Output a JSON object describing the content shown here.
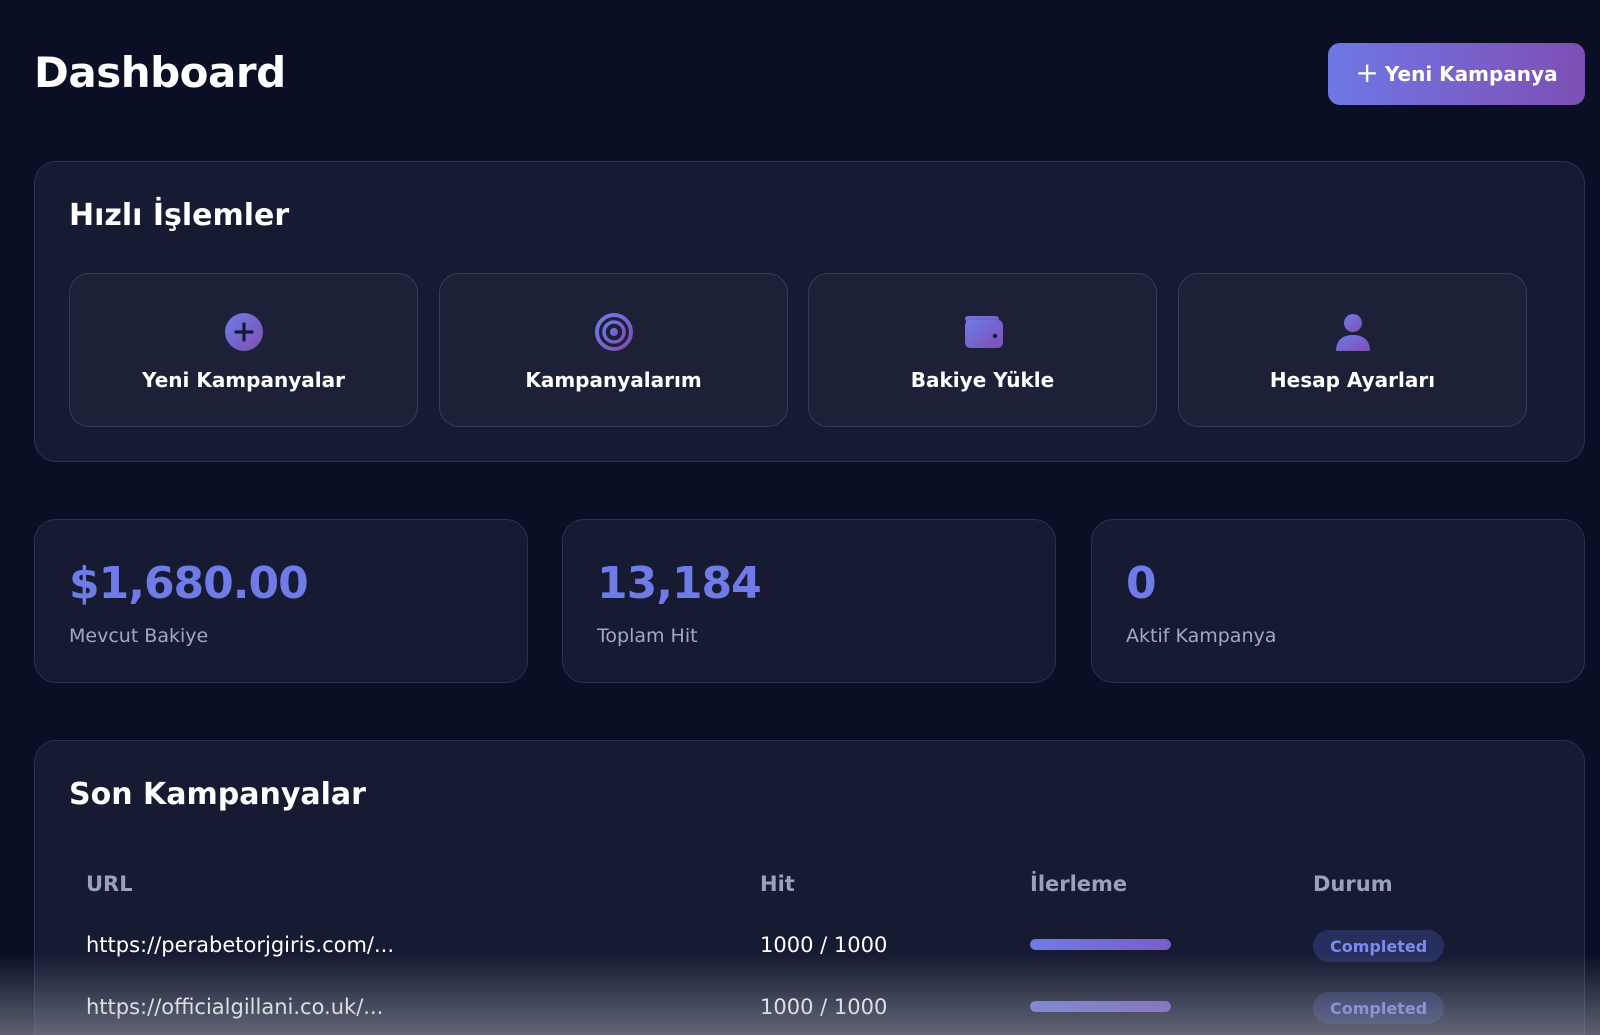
{
  "header": {
    "title": "Dashboard",
    "new_campaign_button": "Yeni Kampanya"
  },
  "quick_actions": {
    "title": "Hızlı İşlemler",
    "items": [
      {
        "label": "Yeni Kampanyalar",
        "icon": "plus-circle-icon"
      },
      {
        "label": "Kampanyalarım",
        "icon": "target-icon"
      },
      {
        "label": "Bakiye Yükle",
        "icon": "wallet-icon"
      },
      {
        "label": "Hesap Ayarları",
        "icon": "user-icon"
      }
    ]
  },
  "stats": [
    {
      "value": "$1,680.00",
      "label": "Mevcut Bakiye"
    },
    {
      "value": "13,184",
      "label": "Toplam Hit"
    },
    {
      "value": "0",
      "label": "Aktif Kampanya"
    }
  ],
  "recent_campaigns": {
    "title": "Son Kampanyalar",
    "columns": [
      "URL",
      "Hit",
      "İlerleme",
      "Durum"
    ],
    "rows": [
      {
        "url": "https://perabetorjgiris.com/...",
        "hit": "1000 / 1000",
        "progress": 1.0,
        "status": "Completed"
      },
      {
        "url": "https://officialgillani.co.uk/...",
        "hit": "1000 / 1000",
        "progress": 1.0,
        "status": "Completed"
      }
    ]
  },
  "colors": {
    "background": "#0a0f25",
    "card": "#161b33",
    "accent": "#6f7be6",
    "accent_end": "#7d4fb5",
    "badge_bg": "#272f5e"
  }
}
